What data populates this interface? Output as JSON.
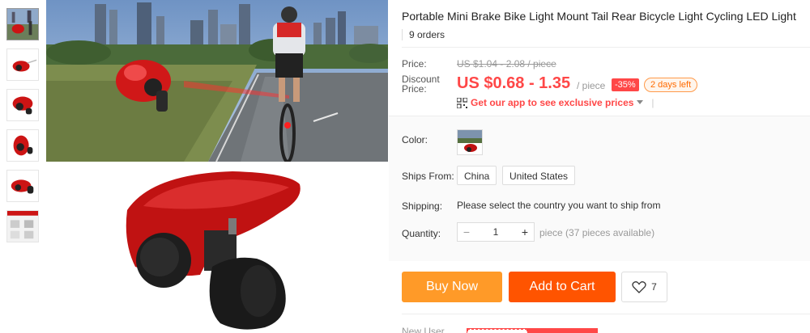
{
  "product": {
    "title": "Portable Mini Brake Bike Light Mount Tail Rear Bicycle Light Cycling LED Light",
    "orders": "9 orders"
  },
  "price": {
    "label": "Price:",
    "original": "US $1.04 - 2.08 / piece",
    "discount_label": "Discount Price:",
    "discount_value": "US $0.68 - 1.35",
    "per_piece": "/ piece",
    "discount_badge": "-35%",
    "days_left": "2 days left",
    "app_link": "Get our app to see exclusive prices",
    "app_separator": "|"
  },
  "options": {
    "color_label": "Color:",
    "ships_from_label": "Ships From:",
    "ships_from": [
      "China",
      "United States"
    ],
    "shipping_label": "Shipping:",
    "shipping_text": "Please select the country you want to ship from",
    "quantity_label": "Quantity:",
    "quantity_value": "1",
    "quantity_minus": "−",
    "quantity_plus": "+",
    "quantity_available": "piece (37 pieces available)"
  },
  "actions": {
    "buy_now": "Buy Now",
    "add_to_cart": "Add to Cart",
    "wishlist_count": "7"
  },
  "footer": {
    "new_user": "New User"
  },
  "colors": {
    "price_red": "#ff4747",
    "buy_now": "#ff9a28",
    "add_to_cart": "#ff5400",
    "product_red": "#cc1414"
  },
  "icons": {
    "qr": "qr-code-icon",
    "dropdown": "chevron-down-icon",
    "wishlist": "heart-icon"
  }
}
